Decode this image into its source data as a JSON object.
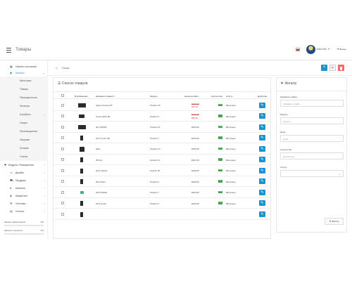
{
  "header": {
    "title": "Товары",
    "user_name": "John Doe",
    "logout_label": "Выход"
  },
  "sidebar": {
    "items": [
      {
        "label": "Панель состояния",
        "icon": "dashboard-icon"
      },
      {
        "label": "Каталог",
        "icon": "tag-icon",
        "active": true
      },
      {
        "label": "Модули / Расширения",
        "icon": "puzzle-icon"
      },
      {
        "label": "Дизайн",
        "icon": "monitor-icon"
      },
      {
        "label": "Продажи",
        "icon": "cart-icon"
      },
      {
        "label": "Клиенты",
        "icon": "user-icon"
      },
      {
        "label": "Маркетинг",
        "icon": "share-icon"
      },
      {
        "label": "Система",
        "icon": "gear-icon"
      },
      {
        "label": "Отчеты",
        "icon": "chart-icon"
      }
    ],
    "catalog_sub": [
      "Категории",
      "Товары",
      "Периодичность",
      "Фильтры",
      "Атрибуты",
      "Опции",
      "Производители",
      "Загрузки",
      "Отзывы",
      "Статьи"
    ],
    "stats": [
      {
        "label": "Заказы завершенные",
        "pct": "0%",
        "value": 0
      },
      {
        "label": "Заказы в процессе",
        "pct": "0%",
        "value": 0
      }
    ]
  },
  "breadcrumb": {
    "item": "Товары"
  },
  "toolbar": {
    "add": "+",
    "refresh": "⟳",
    "delete": "🗑"
  },
  "products": {
    "title": "Список товаров",
    "columns": {
      "image": "Изображение",
      "name": "Название товара",
      "model": "Модель",
      "price": "Цена на сайте",
      "qty": "Количество",
      "status": "Статус",
      "action": "Действие"
    },
    "rows": [
      {
        "name": "Apple Cinema 30\"",
        "model": "Product 15",
        "price_old": "$100.00",
        "price_new": "$90.00",
        "qty": "990",
        "status": "Включено",
        "thumb": "monitor"
      },
      {
        "name": "Canon EOS 5D",
        "model": "Product 3",
        "price_old": "$100.00",
        "price_new": "$80.00",
        "qty": "7",
        "status": "Включено",
        "thumb": "camera"
      },
      {
        "name": "HP LP3065",
        "model": "Product 21",
        "price": "$100.00",
        "qty": "1000",
        "status": "Включено",
        "thumb": "monitor"
      },
      {
        "name": "HTC Touch HD",
        "model": "Product 1",
        "price": "$100.00",
        "qty": "939",
        "status": "Включено",
        "thumb": "phone"
      },
      {
        "name": "iMac",
        "model": "Product 14",
        "price": "$100.00",
        "qty": "977",
        "status": "Включено",
        "thumb": "imac"
      },
      {
        "name": "iPhone",
        "model": "product 11",
        "price": "$101.00",
        "qty": "970",
        "status": "Включено",
        "thumb": "phone"
      },
      {
        "name": "iPod Classic",
        "model": "product 20",
        "price": "$100.00",
        "qty": "995",
        "status": "Включено",
        "thumb": "ipod"
      },
      {
        "name": "iPod Nano",
        "model": "Product 9",
        "price": "$100.00",
        "qty": "994",
        "status": "Включено",
        "thumb": "ipod"
      },
      {
        "name": "iPod Shuffle",
        "model": "Product 7",
        "price": "$100.00",
        "qty": "995",
        "status": "Включено",
        "thumb": "shuffle"
      },
      {
        "name": "iPod Touch",
        "model": "Product 5",
        "price": "$100.00",
        "qty": "999",
        "status": "Включено",
        "thumb": "phone"
      },
      {
        "name": "",
        "model": "",
        "price": "",
        "qty": "",
        "status": "",
        "thumb": "phone"
      }
    ]
  },
  "filter": {
    "title": "Фильтр",
    "fields": [
      {
        "label": "Название товара",
        "placeholder": "Название товара"
      },
      {
        "label": "Модель",
        "placeholder": "Модель"
      },
      {
        "label": "Цена",
        "placeholder": "Цена"
      },
      {
        "label": "Количество",
        "placeholder": "Количество"
      },
      {
        "label": "Статус",
        "placeholder": ""
      }
    ],
    "button": "Фильтр"
  },
  "colors": {
    "accent": "#1e91cf",
    "danger": "#f56b6b",
    "success": "#3aa64e",
    "price_red": "#d24c4c"
  }
}
